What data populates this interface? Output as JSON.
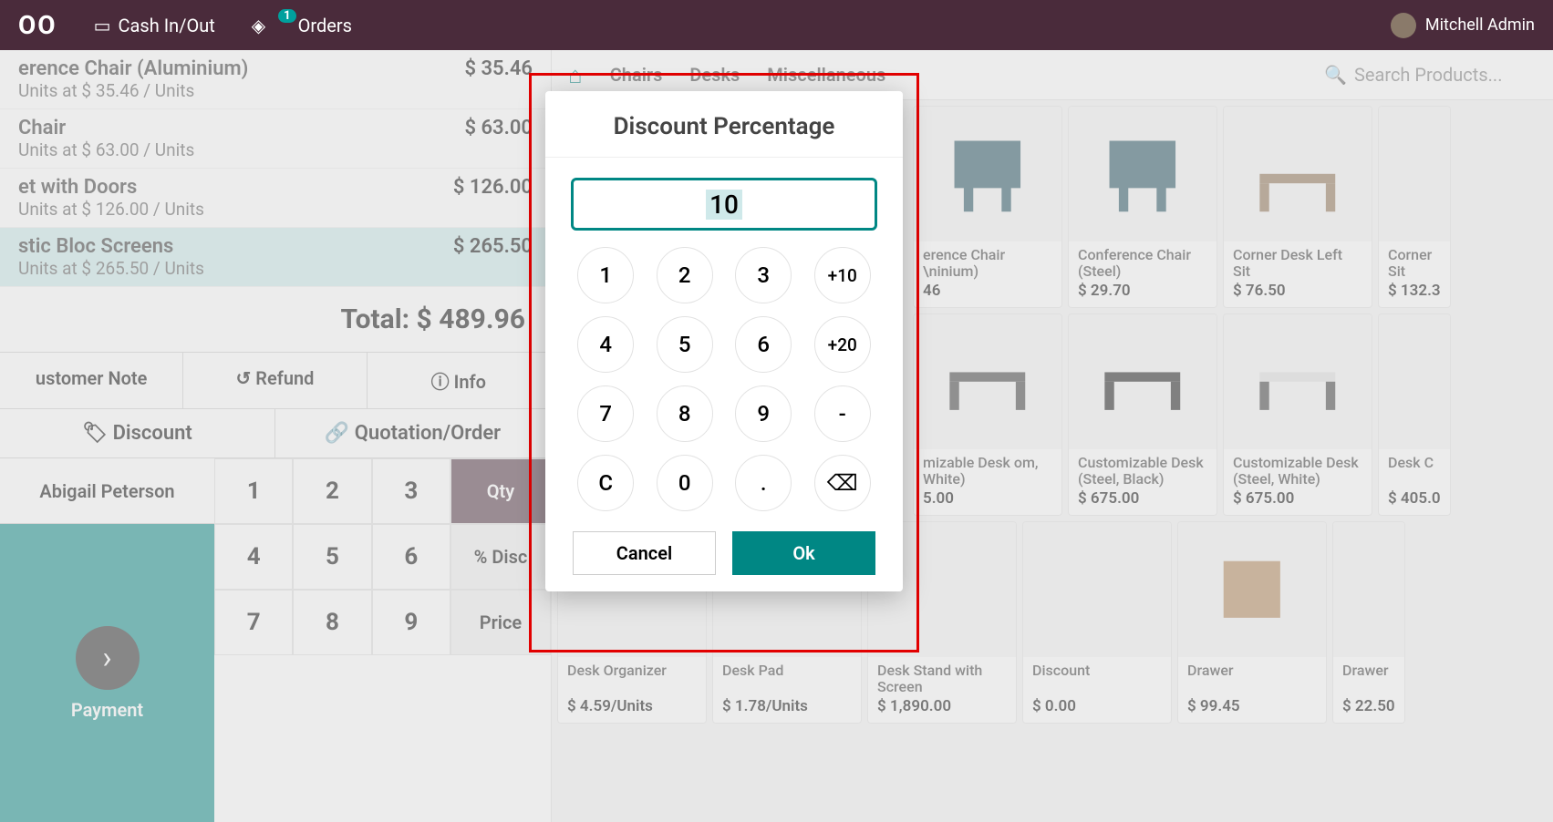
{
  "topbar": {
    "logo": "OO",
    "cash": "Cash In/Out",
    "orders": "Orders",
    "orders_badge": "1",
    "user": "Mitchell Admin"
  },
  "order": {
    "lines": [
      {
        "name": "erence Chair (Aluminium)",
        "sub": "Units at $ 35.46 / Units",
        "price": "$ 35.46"
      },
      {
        "name": "Chair",
        "sub": "Units at $ 63.00 / Units",
        "price": "$ 63.00"
      },
      {
        "name": "et with Doors",
        "sub": "Units at $ 126.00 / Units",
        "price": "$ 126.00"
      },
      {
        "name": "stic Bloc Screens",
        "sub": "Units at $ 265.50 / Units",
        "price": "$ 265.50"
      }
    ],
    "total": "Total: $ 489.96"
  },
  "actions": {
    "note": "ustomer Note",
    "refund": "Refund",
    "info": "Info",
    "discount": "Discount",
    "quotation": "Quotation/Order"
  },
  "bottom": {
    "customer": "Abigail Peterson",
    "payment": "Payment",
    "keys": [
      "1",
      "2",
      "3",
      "4",
      "5",
      "6",
      "7",
      "8",
      "9"
    ],
    "modes": {
      "qty": "Qty",
      "disc": "% Disc",
      "price": "Price"
    }
  },
  "cats": {
    "chairs": "Chairs",
    "desks": "Desks",
    "misc": "Miscellaneous"
  },
  "search": {
    "placeholder": "Search Products..."
  },
  "products": {
    "row1": [
      {
        "name": "erence Chair \\ninium)",
        "price": "46"
      },
      {
        "name": "Conference Chair (Steel)",
        "price": "$ 29.70"
      },
      {
        "name": "Corner Desk Left Sit",
        "price": "$ 76.50"
      },
      {
        "name": "Corner Sit",
        "price": "$ 132.3"
      }
    ],
    "row2": [
      {
        "name": "mizable Desk om, White)",
        "price": "5.00"
      },
      {
        "name": "Customizable Desk (Steel, Black)",
        "price": "$ 675.00"
      },
      {
        "name": "Customizable Desk (Steel, White)",
        "price": "$ 675.00"
      },
      {
        "name": "Desk C",
        "price": "$ 405.0"
      }
    ],
    "row3": [
      {
        "name": "Desk Organizer",
        "price": "$ 4.59/Units"
      },
      {
        "name": "Desk Pad",
        "price": "$ 1.78/Units"
      },
      {
        "name": "Desk Stand with Screen",
        "price": "$ 1,890.00"
      },
      {
        "name": "Discount",
        "price": "$ 0.00"
      },
      {
        "name": "Drawer",
        "price": "$ 99.45"
      },
      {
        "name": "Drawer",
        "price": "$ 22.50"
      }
    ]
  },
  "modal": {
    "title": "Discount Percentage",
    "value": "10",
    "keys": [
      "1",
      "2",
      "3",
      "+10",
      "4",
      "5",
      "6",
      "+20",
      "7",
      "8",
      "9",
      "-",
      "C",
      "0",
      ".",
      "⌫"
    ],
    "cancel": "Cancel",
    "ok": "Ok"
  }
}
